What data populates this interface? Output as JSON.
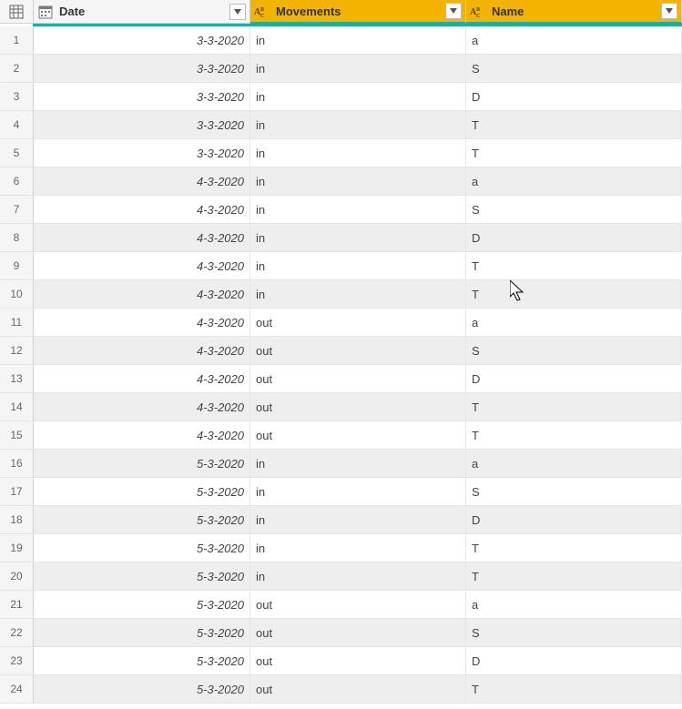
{
  "columns": {
    "date": {
      "label": "Date",
      "type": "date"
    },
    "mov": {
      "label": "Movements",
      "type": "text"
    },
    "name": {
      "label": "Name",
      "type": "text"
    }
  },
  "rows": [
    {
      "n": "1",
      "date": "3-3-2020",
      "mov": "in",
      "name": "a"
    },
    {
      "n": "2",
      "date": "3-3-2020",
      "mov": "in",
      "name": "S"
    },
    {
      "n": "3",
      "date": "3-3-2020",
      "mov": "in",
      "name": "D"
    },
    {
      "n": "4",
      "date": "3-3-2020",
      "mov": "in",
      "name": "T"
    },
    {
      "n": "5",
      "date": "3-3-2020",
      "mov": "in",
      "name": "T"
    },
    {
      "n": "6",
      "date": "4-3-2020",
      "mov": "in",
      "name": "a"
    },
    {
      "n": "7",
      "date": "4-3-2020",
      "mov": "in",
      "name": "S"
    },
    {
      "n": "8",
      "date": "4-3-2020",
      "mov": "in",
      "name": "D"
    },
    {
      "n": "9",
      "date": "4-3-2020",
      "mov": "in",
      "name": "T"
    },
    {
      "n": "10",
      "date": "4-3-2020",
      "mov": "in",
      "name": "T"
    },
    {
      "n": "11",
      "date": "4-3-2020",
      "mov": "out",
      "name": "a"
    },
    {
      "n": "12",
      "date": "4-3-2020",
      "mov": "out",
      "name": "S"
    },
    {
      "n": "13",
      "date": "4-3-2020",
      "mov": "out",
      "name": "D"
    },
    {
      "n": "14",
      "date": "4-3-2020",
      "mov": "out",
      "name": "T"
    },
    {
      "n": "15",
      "date": "4-3-2020",
      "mov": "out",
      "name": "T"
    },
    {
      "n": "16",
      "date": "5-3-2020",
      "mov": "in",
      "name": "a"
    },
    {
      "n": "17",
      "date": "5-3-2020",
      "mov": "in",
      "name": "S"
    },
    {
      "n": "18",
      "date": "5-3-2020",
      "mov": "in",
      "name": "D"
    },
    {
      "n": "19",
      "date": "5-3-2020",
      "mov": "in",
      "name": "T"
    },
    {
      "n": "20",
      "date": "5-3-2020",
      "mov": "in",
      "name": "T"
    },
    {
      "n": "21",
      "date": "5-3-2020",
      "mov": "out",
      "name": "a"
    },
    {
      "n": "22",
      "date": "5-3-2020",
      "mov": "out",
      "name": "S"
    },
    {
      "n": "23",
      "date": "5-3-2020",
      "mov": "out",
      "name": "D"
    },
    {
      "n": "24",
      "date": "5-3-2020",
      "mov": "out",
      "name": "T"
    }
  ]
}
